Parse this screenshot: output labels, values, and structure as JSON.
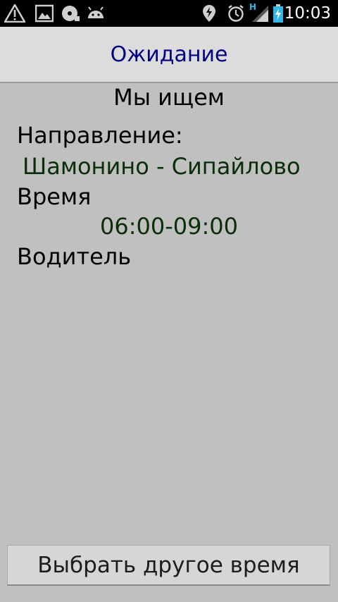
{
  "status_bar": {
    "time": "10:03",
    "network_label": "H",
    "icons": [
      "warning-icon",
      "image-icon",
      "cd-icon",
      "android-icon",
      "location-icon",
      "alarm-icon",
      "signal-icon",
      "battery-charging-icon"
    ]
  },
  "header": {
    "title": "Ожидание"
  },
  "main": {
    "heading": "Мы ищем",
    "direction_label": "Направление:",
    "direction_value": "Шамонино - Сипайлово",
    "time_label": "Время",
    "time_value": "06:00-09:00",
    "driver_label": "Водитель"
  },
  "footer": {
    "button_label": "Выбрать другое время"
  },
  "colors": {
    "background": "#c0c0c0",
    "title": "#000080",
    "value": "#0a2e0a",
    "status_bar": "#000000",
    "status_accent": "#33b5e5"
  }
}
